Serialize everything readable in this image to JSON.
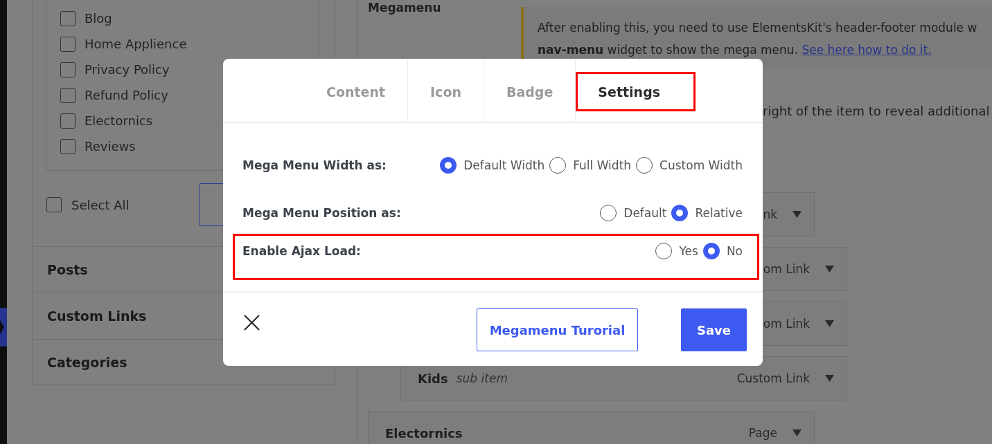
{
  "sidebar": {
    "pages": [
      {
        "label": "Blog",
        "checked": false
      },
      {
        "label": "Home Applience",
        "checked": false
      },
      {
        "label": "Privacy Policy",
        "checked": false
      },
      {
        "label": "Refund Policy",
        "checked": false
      },
      {
        "label": "Electornics",
        "checked": false
      },
      {
        "label": "Reviews",
        "checked": false
      }
    ],
    "select_all": {
      "label": "Select All",
      "checked": false
    },
    "sections": [
      {
        "title": "Posts"
      },
      {
        "title": "Custom Links"
      },
      {
        "title": "Categories"
      }
    ]
  },
  "main": {
    "heading": "Megamenu",
    "notice": {
      "line_1": "After enabling this, you need to use ElementsKit's header-footer module w",
      "line_2": "**nav-menu** widget to show the mega menu.",
      "link": "See here how to do it."
    },
    "hint": "right of the item to reveal additional",
    "menu_items": [
      {
        "type_label": "nk",
        "children": [
          {
            "type_label": "om Link"
          },
          {
            "type_label": "om Link"
          },
          {
            "title": "Kids",
            "subtitle": "sub item",
            "type_label": "Custom Link"
          }
        ]
      },
      {
        "title": "Electornics",
        "type_label": "Page"
      }
    ]
  },
  "modal": {
    "tabs": [
      {
        "label": "Content",
        "selected": false,
        "highlighted": false
      },
      {
        "label": "Icon",
        "selected": false,
        "highlighted": false
      },
      {
        "label": "Badge",
        "selected": false,
        "highlighted": false
      },
      {
        "label": "Settings",
        "selected": true,
        "highlighted": true
      }
    ],
    "settings": [
      {
        "label": "Mega Menu Width as:",
        "highlighted": false,
        "options": [
          {
            "label": "Default Width",
            "selected": true
          },
          {
            "label": "Full Width",
            "selected": false
          },
          {
            "label": "Custom Width",
            "selected": false
          }
        ]
      },
      {
        "label": "Mega Menu Position as:",
        "highlighted": false,
        "options": [
          {
            "label": "Default",
            "selected": false
          },
          {
            "label": "Relative",
            "selected": true
          }
        ]
      },
      {
        "label": "Enable Ajax Load:",
        "highlighted": true,
        "options": [
          {
            "label": "Yes",
            "selected": false
          },
          {
            "label": "No",
            "selected": true
          }
        ]
      }
    ],
    "tutorial_button": "Megamenu Turorial",
    "save_button": "Save"
  }
}
